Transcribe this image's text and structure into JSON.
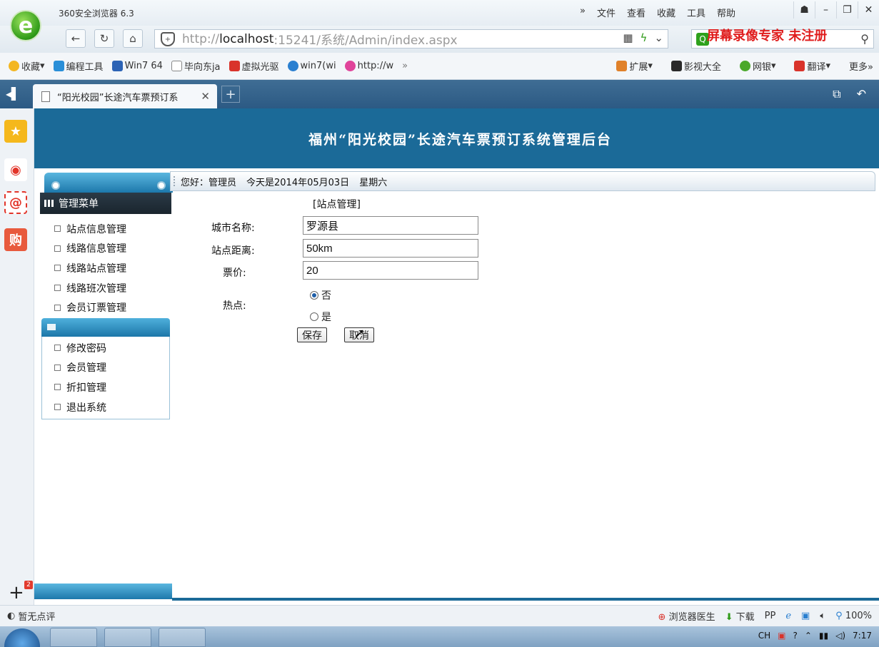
{
  "browser": {
    "app_title": "360安全浏览器 6.3",
    "menu": [
      "»",
      "文件",
      "查看",
      "收藏",
      "工具",
      "帮助"
    ],
    "url_prefix": "http://",
    "url_host": "localhost",
    "url_rest": ":15241/系统/Admin/index.aspx",
    "watermark": "屏幕录像专家 未注册",
    "bookmarks": [
      "收藏",
      "编程工具",
      "Win7 64",
      "毕向东ja",
      "虚拟光驱",
      "win7(wi",
      "http://w",
      "»"
    ],
    "bookmarks_right": [
      "扩展",
      "影视大全",
      "网银",
      "翻译",
      "更多»"
    ],
    "tab_title": "“阳光校园”长途汽车票预订系",
    "status_left": "暂无点评",
    "status_right": [
      "浏览器医生",
      "下载",
      "100%"
    ],
    "clock": "7:17",
    "tray_lang": "CH"
  },
  "page": {
    "title": "福州“阳光校园”长途汽车票预订系统管理后台",
    "greeting": {
      "hello": "您好：管理员",
      "today": "今天是2014年05月03日",
      "weekday": "星期六"
    },
    "menu": {
      "header": "管理菜单",
      "group1": [
        "站点信息管理",
        "线路信息管理",
        "线路站点管理",
        "线路班次管理",
        "会员订票管理"
      ],
      "group2": [
        "修改密码",
        "会员管理",
        "折扣管理",
        "退出系统"
      ]
    },
    "form": {
      "title": "[站点管理]",
      "city_label": "城市名称:",
      "city_value": "罗源县",
      "distance_label": "站点距离:",
      "distance_value": "50km",
      "price_label": "票价:",
      "price_value": "20",
      "hot_label": "热点:",
      "hot_no": "否",
      "hot_yes": "是",
      "hot_selected": "否",
      "save_label": "保存",
      "cancel_label": "取消"
    }
  },
  "colors": {
    "header_bg": "#1b6a98",
    "tab_bar": "#2c5a84",
    "watermark": "#e01e1e"
  }
}
